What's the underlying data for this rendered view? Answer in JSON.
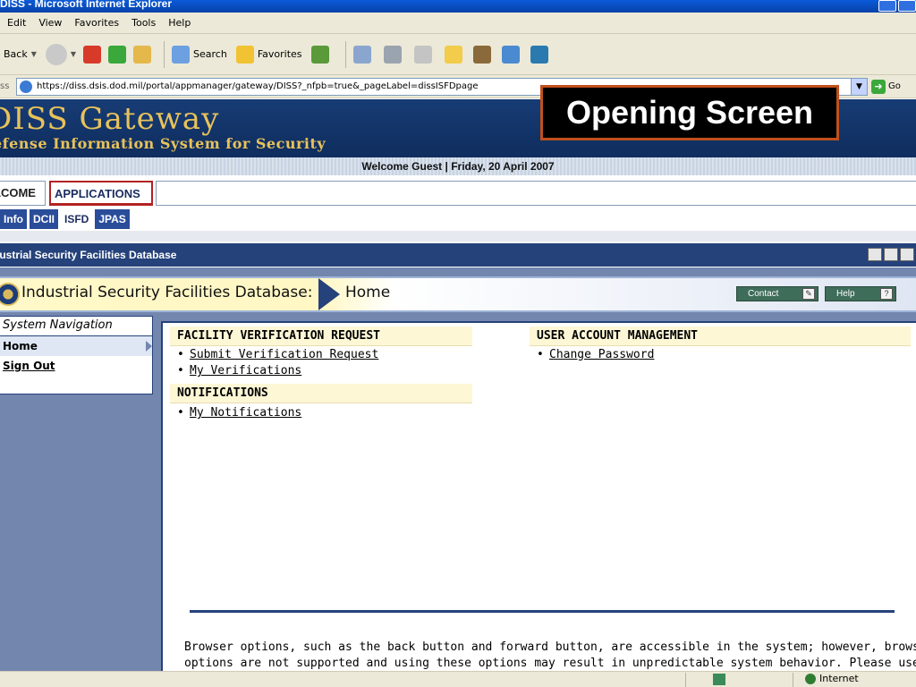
{
  "window": {
    "title": "DISS - Microsoft Internet Explorer"
  },
  "menu": {
    "items": [
      "Edit",
      "View",
      "Favorites",
      "Tools",
      "Help"
    ]
  },
  "toolbar": {
    "back_label": "Back",
    "search_label": "Search",
    "favorites_label": "Favorites"
  },
  "address": {
    "label": "ss",
    "url": "https://diss.dsis.dod.mil/portal/appmanager/gateway/DISS?_nfpb=true&_pageLabel=dissISFDpage",
    "go_label": "Go"
  },
  "banner": {
    "title": "DISS Gateway",
    "subtitle": "efense Information System for Security",
    "overlay_label": "Opening Screen"
  },
  "welcome": {
    "text": "Welcome Guest |  Friday, 20 April 2007"
  },
  "app_tabs": {
    "welcome": "LCOME",
    "applications": "APPLICATIONS"
  },
  "sub_tabs": [
    "Info",
    "DCII",
    "ISFD",
    "JPAS"
  ],
  "portlet": {
    "title": "lustrial Security Facilities Database"
  },
  "app_header": {
    "title": "Industrial Security Facilities Database:",
    "current": "Home",
    "contact_label": "Contact",
    "help_label": "Help"
  },
  "sidenav": {
    "title": "System Navigation",
    "items": [
      "Home",
      "Sign Out"
    ]
  },
  "sections": {
    "facility_title": "FACILITY VERIFICATION REQUEST",
    "facility_links": [
      "Submit Verification Request",
      "My Verifications"
    ],
    "notifications_title": "NOTIFICATIONS",
    "notifications_links": [
      "My Notifications"
    ],
    "user_title": "USER ACCOUNT MANAGEMENT",
    "user_links": [
      "Change Password"
    ]
  },
  "notice": {
    "line1": "Browser options, such as the back button and forward button, are accessible in the system; however, browser",
    "line2": "options are not supported and using these options may result in unpredictable system behavior. Please use the"
  },
  "status": {
    "zone": "Internet"
  },
  "colors": {
    "brand_navy": "#25427a",
    "brand_gold": "#e8c25a",
    "overlay_border": "#c0501c"
  }
}
